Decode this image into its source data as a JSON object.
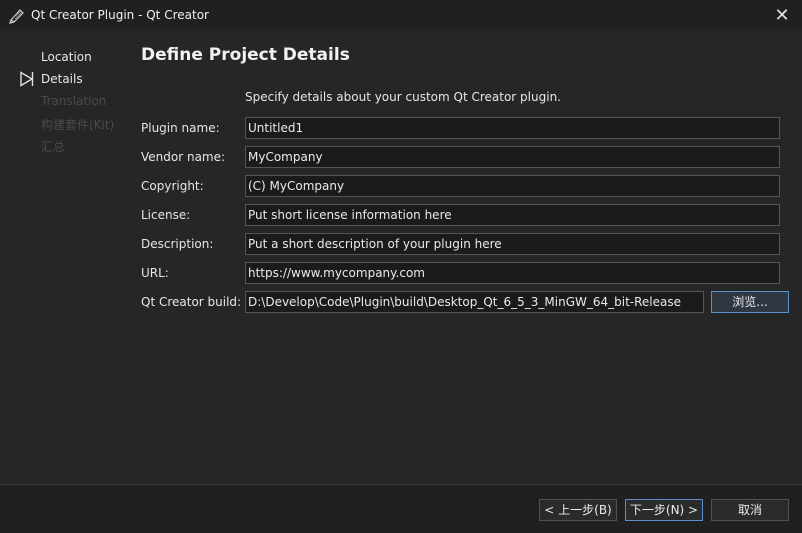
{
  "window": {
    "title": "Qt Creator Plugin - Qt Creator",
    "close_glyph": "✕",
    "app_icon": "pencil-icon"
  },
  "sidebar": {
    "current_marker_icon": "triangle-outline-icon",
    "steps": [
      {
        "label": "Location",
        "state": "done"
      },
      {
        "label": "Details",
        "state": "current"
      },
      {
        "label": "Translation",
        "state": "disabled"
      },
      {
        "label": "构建套件(Kit)",
        "state": "disabled"
      },
      {
        "label": "汇总",
        "state": "disabled"
      }
    ]
  },
  "page": {
    "title": "Define Project Details",
    "subtitle": "Specify details about your custom Qt Creator plugin."
  },
  "form": {
    "plugin_name": {
      "label": "Plugin name:",
      "value": "Untitled1"
    },
    "vendor_name": {
      "label": "Vendor name:",
      "value": "MyCompany"
    },
    "copyright": {
      "label": "Copyright:",
      "value": "(C) MyCompany"
    },
    "license": {
      "label": "License:",
      "value": "Put short license information here"
    },
    "description": {
      "label": "Description:",
      "value": "Put a short description of your plugin here"
    },
    "url": {
      "label": "URL:",
      "value": "https://www.mycompany.com"
    },
    "qt_creator_build": {
      "label": "Qt Creator build:",
      "value": "D:\\Develop\\Code\\Plugin\\build\\Desktop_Qt_6_5_3_MinGW_64_bit-Release"
    },
    "browse_label": "浏览..."
  },
  "footer": {
    "back_label": "< 上一步(B)",
    "next_label": "下一步(N) >",
    "cancel_label": "取消"
  },
  "colors": {
    "background": "#262626",
    "accent_border": "#5d8fc8",
    "disabled_text": "#4a4a4a"
  }
}
